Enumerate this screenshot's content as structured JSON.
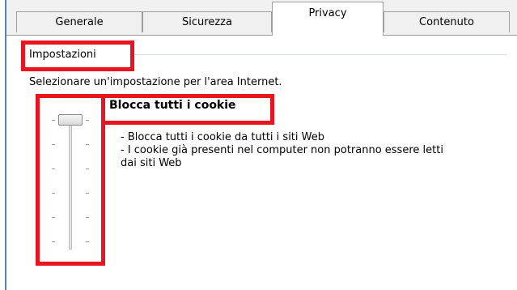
{
  "tabs": [
    {
      "label": "Generale"
    },
    {
      "label": "Sicurezza"
    },
    {
      "label": "Privacy"
    },
    {
      "label": "Contenuto"
    }
  ],
  "active_tab": "Privacy",
  "settings_group": {
    "title": "Impostazioni",
    "instruction": "Selezionare un'impostazione per l'area Internet.",
    "slider_level_label": "Blocca tutti i cookie",
    "description_lines": [
      "- Blocca tutti i cookie da tutti i siti Web",
      "- I cookie già presenti nel computer non potranno essere letti",
      "dai siti Web"
    ]
  },
  "highlight_color": "#e8141f"
}
